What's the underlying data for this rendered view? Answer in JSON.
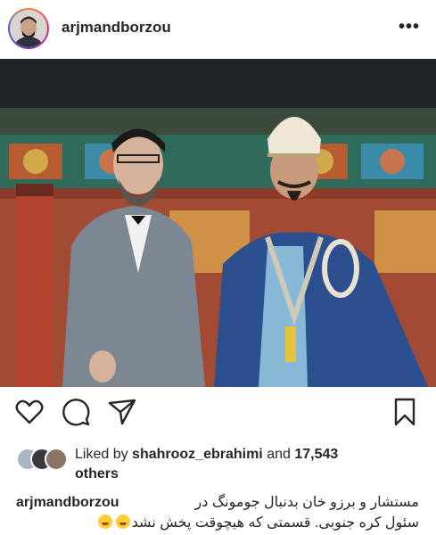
{
  "header": {
    "username": "arjmandborzou",
    "more_label": "•••"
  },
  "post": {
    "image_description_icon": "photo"
  },
  "actions": {
    "like_icon": "heart-icon",
    "comment_icon": "comment-icon",
    "share_icon": "send-icon",
    "save_icon": "bookmark-icon"
  },
  "likes": {
    "prefix": "Liked by ",
    "user": "shahrooz_ebrahimi",
    "middle": " and ",
    "count": "17,543",
    "suffix": "others"
  },
  "caption": {
    "username": "arjmandborzou",
    "text_line1": "مستشار و برزو خان بدنبال جومونگ در",
    "text_line2": "سئول کره جنوبی. قسمتی که هیچوقت پخش نشد"
  },
  "colors": {
    "text": "#262626",
    "background": "#ffffff"
  }
}
